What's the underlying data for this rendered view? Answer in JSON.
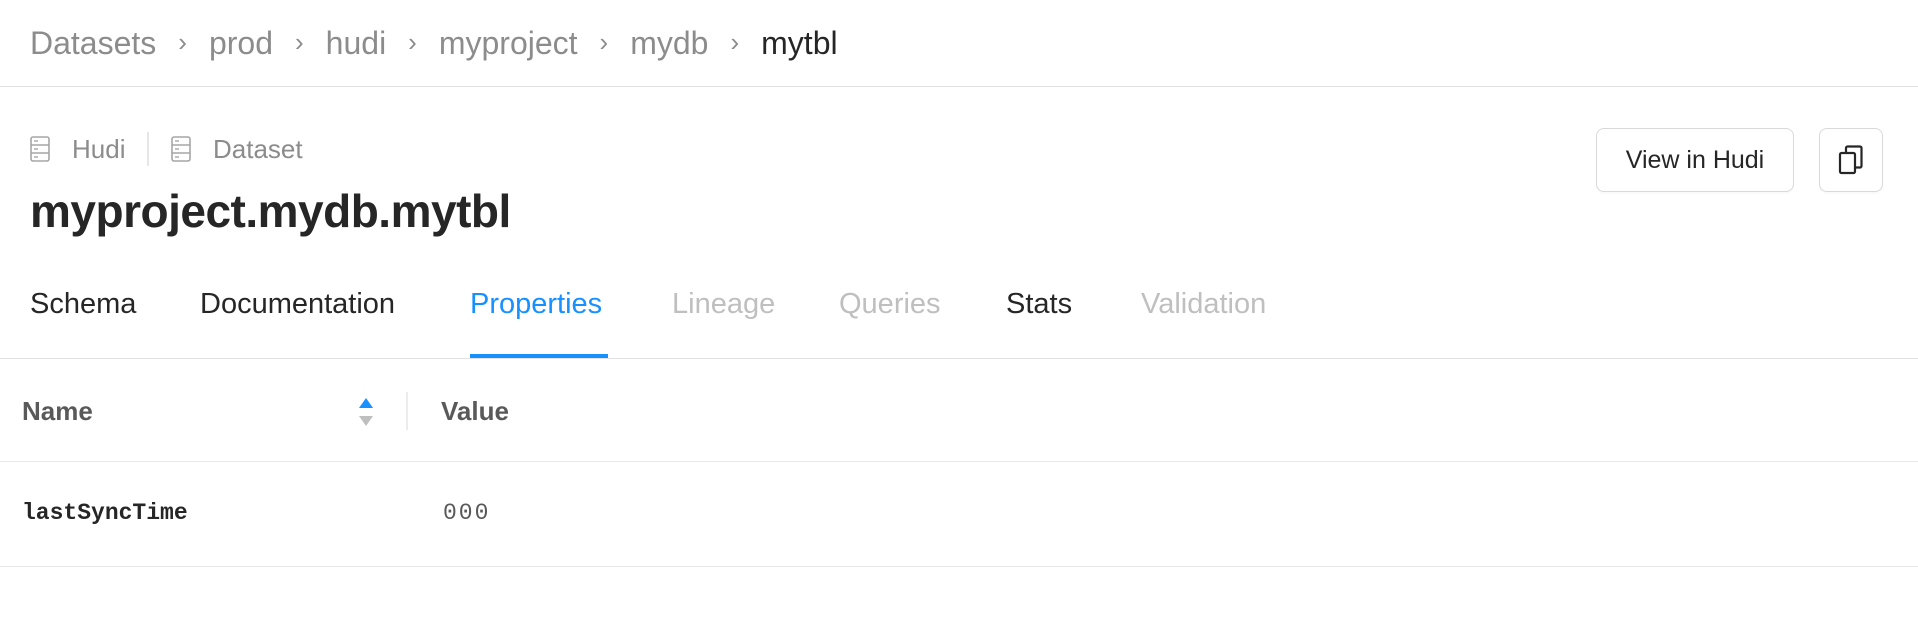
{
  "breadcrumb": {
    "items": [
      "Datasets",
      "prod",
      "hudi",
      "myproject",
      "mydb",
      "mytbl"
    ],
    "separator": "›"
  },
  "entity": {
    "platform": "Hudi",
    "type": "Dataset",
    "title": "myproject.mydb.mytbl"
  },
  "actions": {
    "view_label": "View in Hudi",
    "copy_icon": "copy-icon"
  },
  "tabs": [
    {
      "label": "Schema",
      "state": "enabled"
    },
    {
      "label": "Documentation",
      "state": "enabled"
    },
    {
      "label": "Properties",
      "state": "active"
    },
    {
      "label": "Lineage",
      "state": "disabled"
    },
    {
      "label": "Queries",
      "state": "disabled"
    },
    {
      "label": "Stats",
      "state": "enabled"
    },
    {
      "label": "Validation",
      "state": "disabled"
    }
  ],
  "properties_table": {
    "columns": [
      "Name",
      "Value"
    ],
    "rows": [
      {
        "name": "lastSyncTime",
        "value": "000"
      }
    ]
  },
  "colors": {
    "accent": "#1890ff",
    "text_primary": "#262626",
    "text_secondary": "#8c8c8c",
    "text_disabled": "#bfbfbf",
    "border": "#e2e2e2"
  }
}
